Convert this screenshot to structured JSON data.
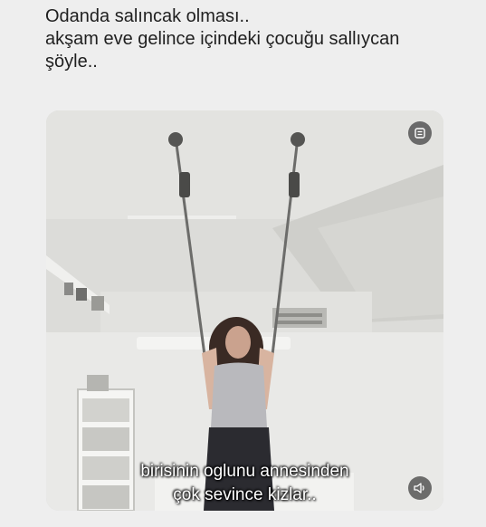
{
  "post": {
    "text_lines": [
      "Odanda salıncak olması..",
      "akşam eve gelince içindeki çocuğu sallıycan",
      "şöyle.."
    ]
  },
  "video": {
    "caption_lines": [
      "birisinin oglunu annesinden",
      "çok sevince kizlar.."
    ],
    "icons": {
      "top_right": "video-settings-icon",
      "bottom_right": "volume-icon"
    }
  }
}
